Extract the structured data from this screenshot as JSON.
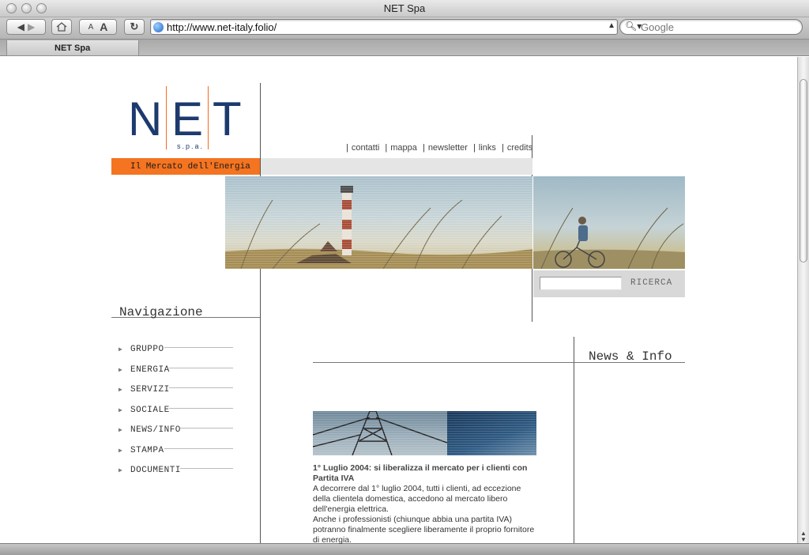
{
  "browser": {
    "window_title": "NET Spa",
    "url": "http://www.net-italy.folio/",
    "search_placeholder": "Google",
    "tab_label": "NET Spa",
    "text_small_label": "A",
    "text_large_label": "A"
  },
  "site": {
    "logo_letters": [
      "N",
      "E",
      "T"
    ],
    "logo_subtitle": "s.p.a.",
    "tagline": "Il Mercato dell'Energia",
    "top_links": [
      "contatti",
      "mappa",
      "newsletter",
      "links",
      "credits"
    ],
    "search_button": "RICERCA",
    "navigation": {
      "title": "Navigazione",
      "items": [
        {
          "label": "GRUPPO"
        },
        {
          "label": "ENERGIA"
        },
        {
          "label": "SERVIZI"
        },
        {
          "label": "SOCIALE"
        },
        {
          "label": "NEWS/INFO"
        },
        {
          "label": "STAMPA"
        },
        {
          "label": "DOCUMENTI"
        }
      ]
    },
    "news": {
      "title": "News & Info"
    },
    "article": {
      "title": "1° Luglio 2004: si liberalizza il mercato per i clienti con Partita IVA",
      "body_1": "A decorrere dal 1° luglio 2004, tutti i clienti, ad eccezione della clientela domestica, accedono al mercato libero dell'energia elettrica.",
      "body_2": "Anche i professionisti (chiunque abbia una partita IVA) potranno finalmente scegliere liberamente il proprio fornitore di energia."
    }
  },
  "colors": {
    "brand_blue": "#1d3a6e",
    "brand_orange": "#f47421"
  }
}
